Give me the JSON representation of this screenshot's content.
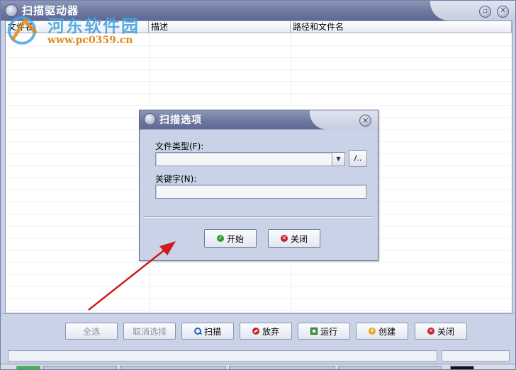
{
  "window": {
    "title": "扫描驱动器"
  },
  "watermark": {
    "name": "河东软件园",
    "url": "www.pc0359.cn"
  },
  "columns": [
    "文件名",
    "描述",
    "路径和文件名"
  ],
  "toolbar": {
    "buttons": [
      {
        "label": "全选",
        "icon": "",
        "enabled": false
      },
      {
        "label": "取消选择",
        "icon": "",
        "enabled": false
      },
      {
        "label": "扫描",
        "icon": "search-icon",
        "enabled": true
      },
      {
        "label": "放弃",
        "icon": "stop-icon",
        "enabled": true
      },
      {
        "label": "运行",
        "icon": "run-icon",
        "enabled": true
      },
      {
        "label": "创建",
        "icon": "add-icon",
        "enabled": true
      },
      {
        "label": "关闭",
        "icon": "close-icon",
        "enabled": true
      }
    ]
  },
  "dialog": {
    "title": "扫描选项",
    "file_type_label": "文件类型(F):",
    "file_type_value": "",
    "browse_label": "/..",
    "keyword_label": "关键字(N):",
    "keyword_value": "",
    "start_button": "开始",
    "close_button": "关闭"
  },
  "colors": {
    "window_bg": "#c9d2e6",
    "titlebar": "#6d78a0",
    "annotation_arrow": "#d11a1a"
  }
}
